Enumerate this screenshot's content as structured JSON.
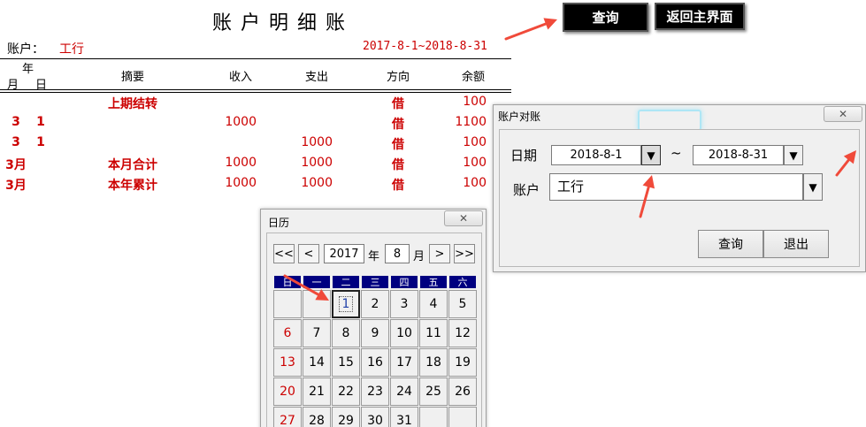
{
  "ledger": {
    "title": "账户明细账",
    "account_label": "账户：",
    "account_value": "工行",
    "period": "2017-8-1~2018-8-31",
    "headers": {
      "year": "年",
      "month": "月",
      "day": "日",
      "summary": "摘要",
      "income": "收入",
      "expense": "支出",
      "direction": "方向",
      "balance": "余额"
    },
    "rows": [
      {
        "month": "",
        "day": "",
        "summary": "上期结转",
        "income": "",
        "expense": "",
        "direction": "借",
        "balance": "100"
      },
      {
        "month": "3",
        "day": "1",
        "summary": "",
        "income": "1000",
        "expense": "",
        "direction": "借",
        "balance": "1100"
      },
      {
        "month": "3",
        "day": "1",
        "summary": "",
        "income": "",
        "expense": "1000",
        "direction": "借",
        "balance": "100"
      },
      {
        "month": "3月",
        "day": "",
        "summary": "本月合计",
        "income": "1000",
        "expense": "1000",
        "direction": "借",
        "balance": "100"
      },
      {
        "month": "3月",
        "day": "",
        "summary": "本年累计",
        "income": "1000",
        "expense": "1000",
        "direction": "借",
        "balance": "100"
      }
    ]
  },
  "toolbar": {
    "query_label": "查询",
    "back_label": "返回主界面"
  },
  "reconcile_dialog": {
    "title": "账户对账",
    "close_glyph": "✕",
    "date_label": "日期",
    "date_from": "2018-8-1",
    "tilde": "~",
    "date_to": "2018-8-31",
    "account_label": "账户",
    "account_value": "工行",
    "dropdown_glyph": "▼",
    "query_label": "查询",
    "exit_label": "退出"
  },
  "calendar": {
    "title": "日历",
    "close_glyph": "✕",
    "prev_year_glyph": "<<",
    "prev_month_glyph": "<",
    "next_month_glyph": ">",
    "next_year_glyph": ">>",
    "year": "2017",
    "year_label": "年",
    "month": "8",
    "month_label": "月",
    "weekdays": [
      "日",
      "一",
      "二",
      "三",
      "四",
      "五",
      "六"
    ],
    "weeks": [
      [
        "",
        "",
        "1",
        "2",
        "3",
        "4",
        "5"
      ],
      [
        "6",
        "7",
        "8",
        "9",
        "10",
        "11",
        "12"
      ],
      [
        "13",
        "14",
        "15",
        "16",
        "17",
        "18",
        "19"
      ],
      [
        "20",
        "21",
        "22",
        "23",
        "24",
        "25",
        "26"
      ],
      [
        "27",
        "28",
        "29",
        "30",
        "31",
        "",
        ""
      ]
    ],
    "selected_day": "1"
  },
  "colors": {
    "accent_red": "#cc0000",
    "annotation_arrow": "#f04a3a",
    "weekday_header": "#000080"
  }
}
